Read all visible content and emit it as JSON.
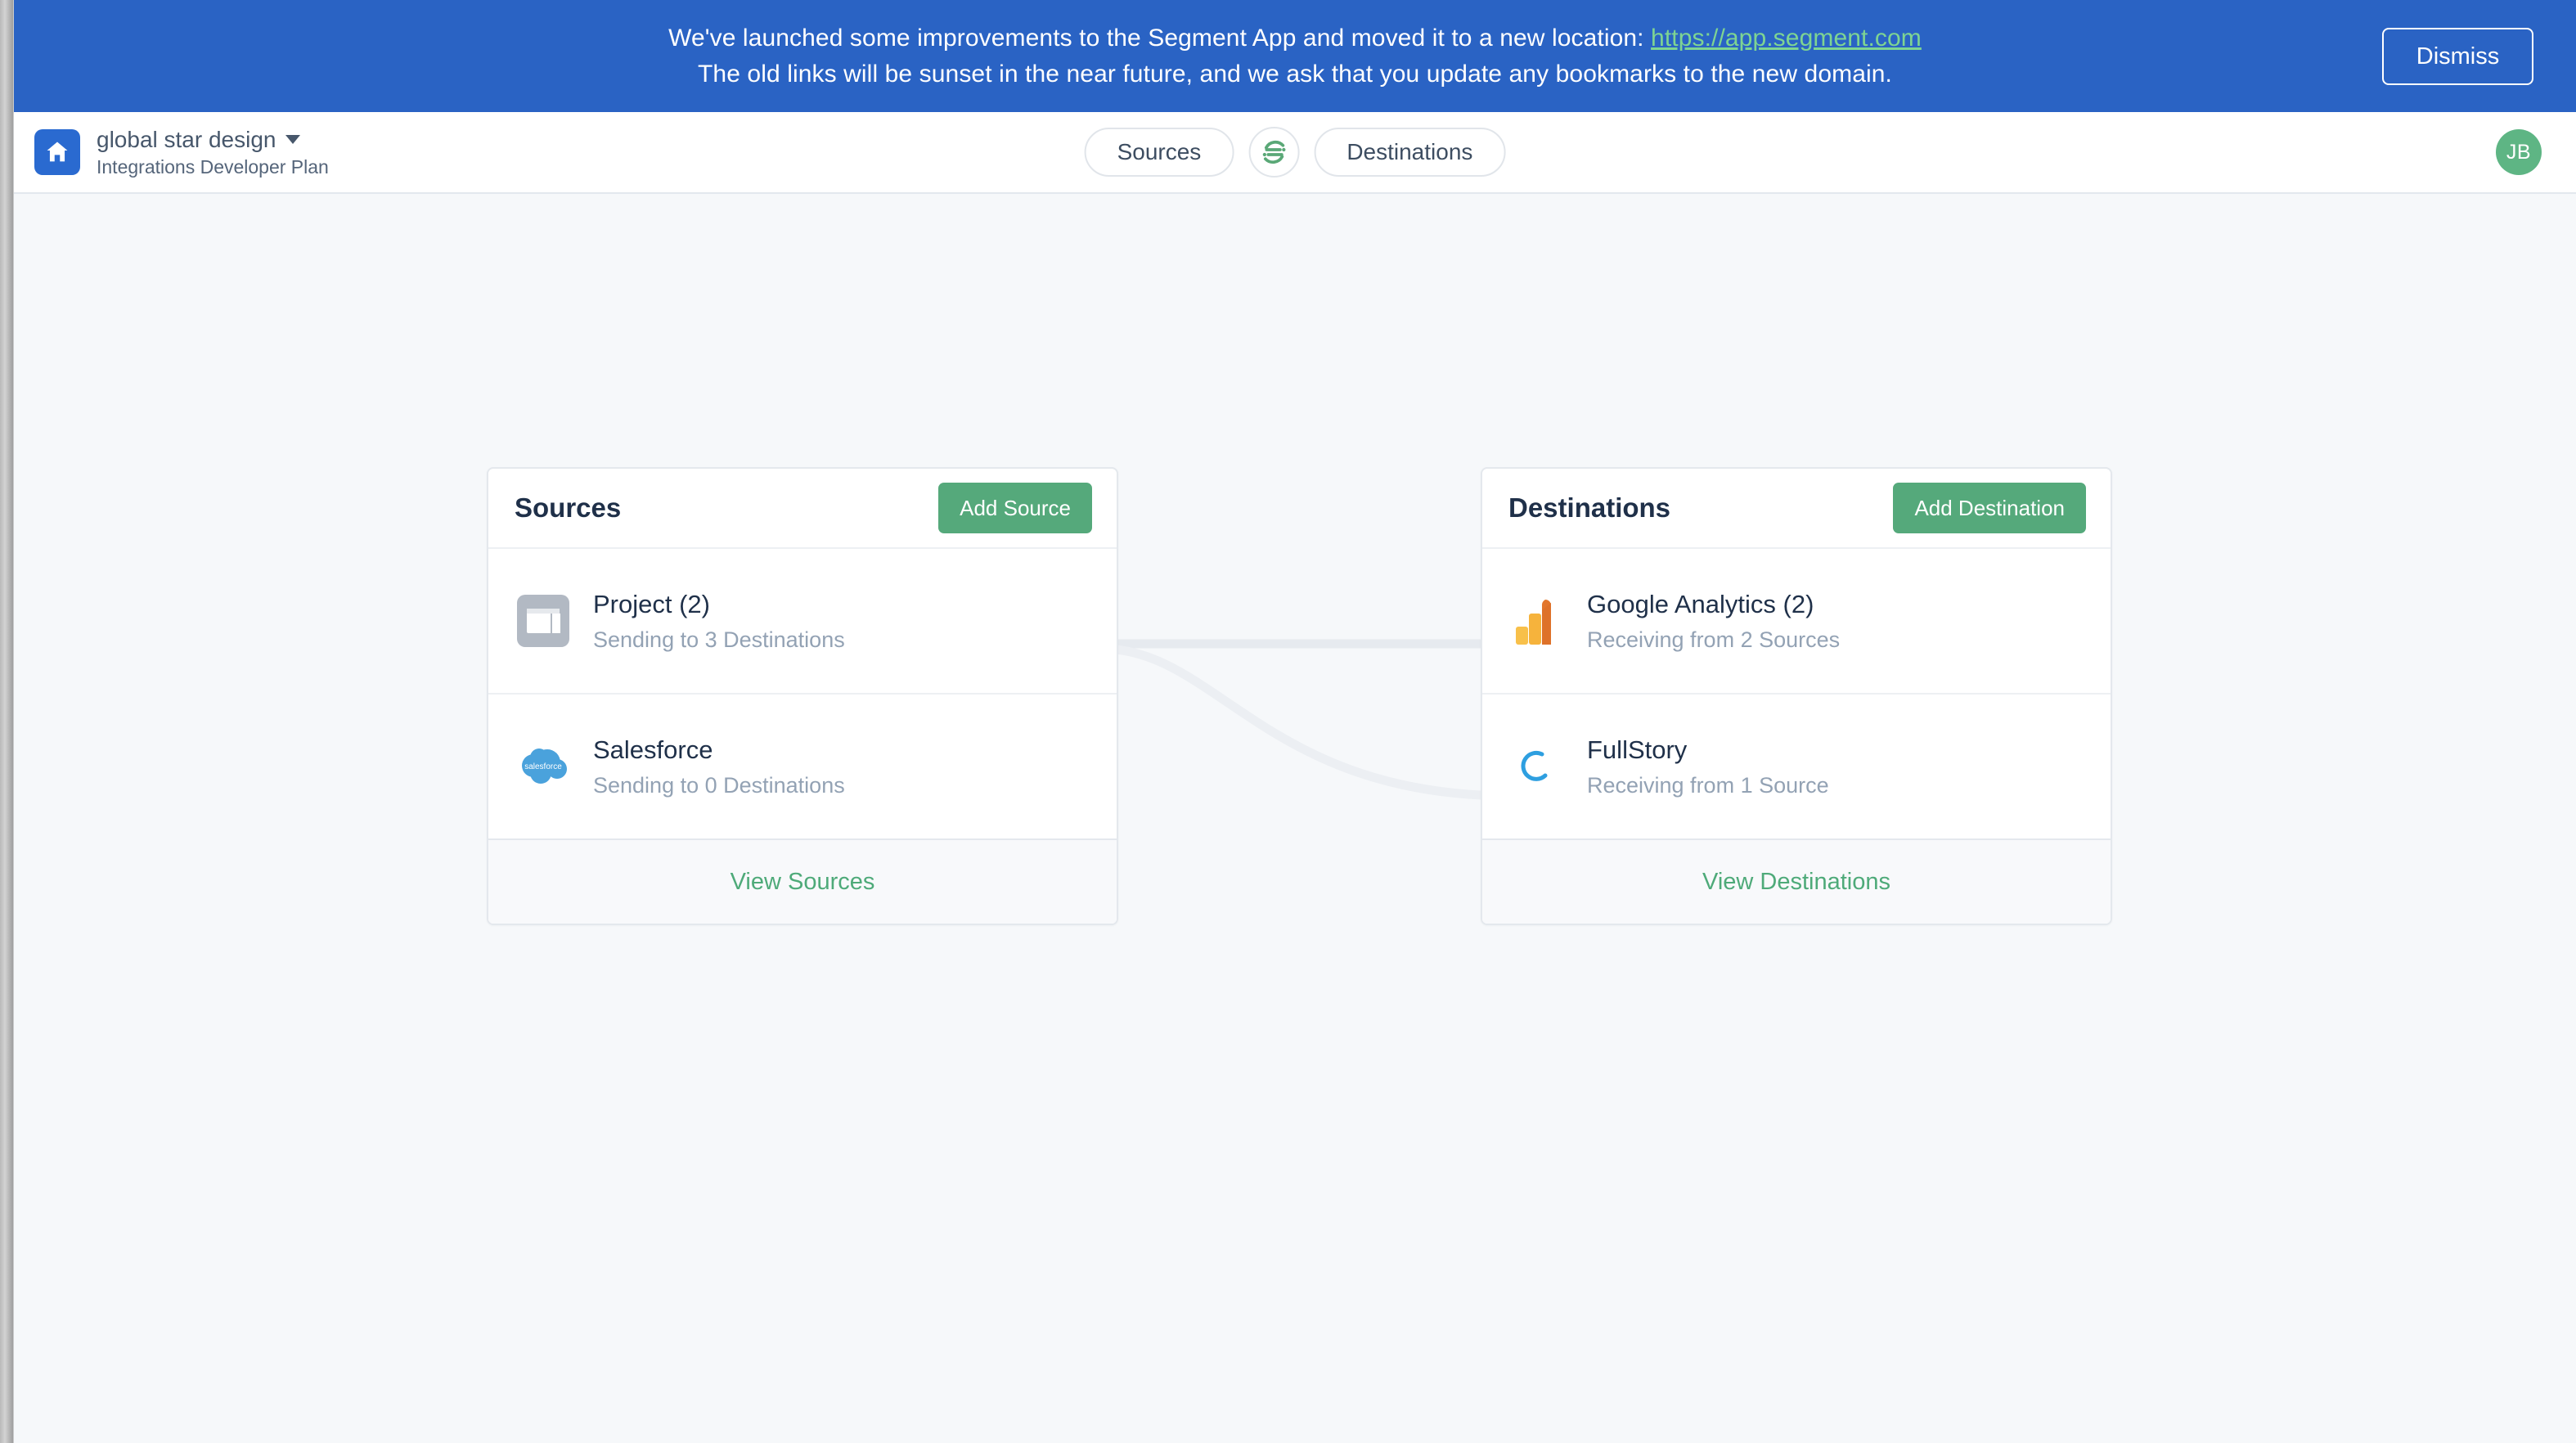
{
  "banner": {
    "line1_before": "We've launched some improvements to the Segment App and moved it to a new location: ",
    "link_text": "https://app.segment.com",
    "line2": "The old links will be sunset in the near future, and we ask that you update any bookmarks to the new domain.",
    "dismiss_label": "Dismiss",
    "background_color": "#2a63c4",
    "link_color": "#7ed492"
  },
  "header": {
    "home_icon": "home-icon",
    "workspace_name": "global star design",
    "workspace_caret": "chevron-down-icon",
    "plan_name": "Integrations Developer Plan",
    "nav": {
      "sources_label": "Sources",
      "segment_logo": "segment-logo-icon",
      "destinations_label": "Destinations"
    },
    "avatar_initials": "JB",
    "avatar_color": "#5eb584"
  },
  "sources_panel": {
    "title": "Sources",
    "add_button_label": "Add Source",
    "footer_link": "View Sources",
    "items": [
      {
        "icon": "project-icon",
        "name": "Project (2)",
        "status": "Sending to 3 Destinations"
      },
      {
        "icon": "salesforce-icon",
        "name": "Salesforce",
        "status": "Sending to 0 Destinations"
      }
    ]
  },
  "destinations_panel": {
    "title": "Destinations",
    "add_button_label": "Add Destination",
    "footer_link": "View Destinations",
    "items": [
      {
        "icon": "google-analytics-icon",
        "name": "Google Analytics (2)",
        "status": "Receiving from 2 Sources"
      },
      {
        "icon": "fullstory-icon",
        "name": "FullStory",
        "status": "Receiving from 1 Source"
      }
    ]
  },
  "theme": {
    "accent_green": "#55a97b",
    "link_green": "#4eaa79",
    "page_background": "#f6f8fa",
    "heading_color": "#1f3049",
    "muted_text": "#93a2b4"
  }
}
